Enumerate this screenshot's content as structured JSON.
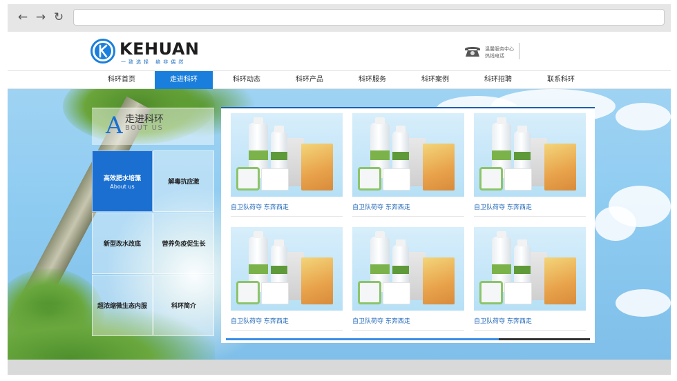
{
  "browser": {
    "back_icon": "arrow-left-icon",
    "forward_icon": "arrow-right-icon",
    "reload_icon": "reload-icon",
    "url": ""
  },
  "header": {
    "logo_text": "KEHUAN",
    "logo_slogan": "一致选择 绝非偶然",
    "hotline_line1": "温馨服务中心",
    "hotline_line2": "热线电话",
    "phone_icon": "phone-icon"
  },
  "nav": {
    "items": [
      {
        "label": "科环首页"
      },
      {
        "label": "走进科环"
      },
      {
        "label": "科环动态"
      },
      {
        "label": "科环产品"
      },
      {
        "label": "科环服务"
      },
      {
        "label": "科环案例"
      },
      {
        "label": "科环招聘"
      },
      {
        "label": "联系科环"
      }
    ],
    "active_color": "#1a7fdc"
  },
  "sidebar": {
    "title_letter": "A",
    "title_zh": "走进科环",
    "title_en": "BOUT US",
    "tiles": [
      {
        "label": "高效肥水培藻",
        "sub": "About us"
      },
      {
        "label": "解毒抗应激",
        "sub": ""
      },
      {
        "label": "新型改水改底",
        "sub": ""
      },
      {
        "label": "营养免疫促生长",
        "sub": ""
      },
      {
        "label": "超浓缩微生态内服",
        "sub": ""
      },
      {
        "label": "科环简介",
        "sub": ""
      }
    ]
  },
  "products": [
    {
      "caption": "自卫队荷夺 东奔西走"
    },
    {
      "caption": "自卫队荷夺 东奔西走"
    },
    {
      "caption": "自卫队荷夺 东奔西走"
    },
    {
      "caption": "自卫队荷夺 东奔西走"
    },
    {
      "caption": "自卫队荷夺 东奔西走"
    },
    {
      "caption": "自卫队荷夺 东奔西走"
    }
  ],
  "scroll": {
    "position_fraction": 0.75
  },
  "colors": {
    "brand_blue": "#1a6fd0",
    "link_blue": "#2167b8",
    "nav_active": "#1a7fdc"
  }
}
